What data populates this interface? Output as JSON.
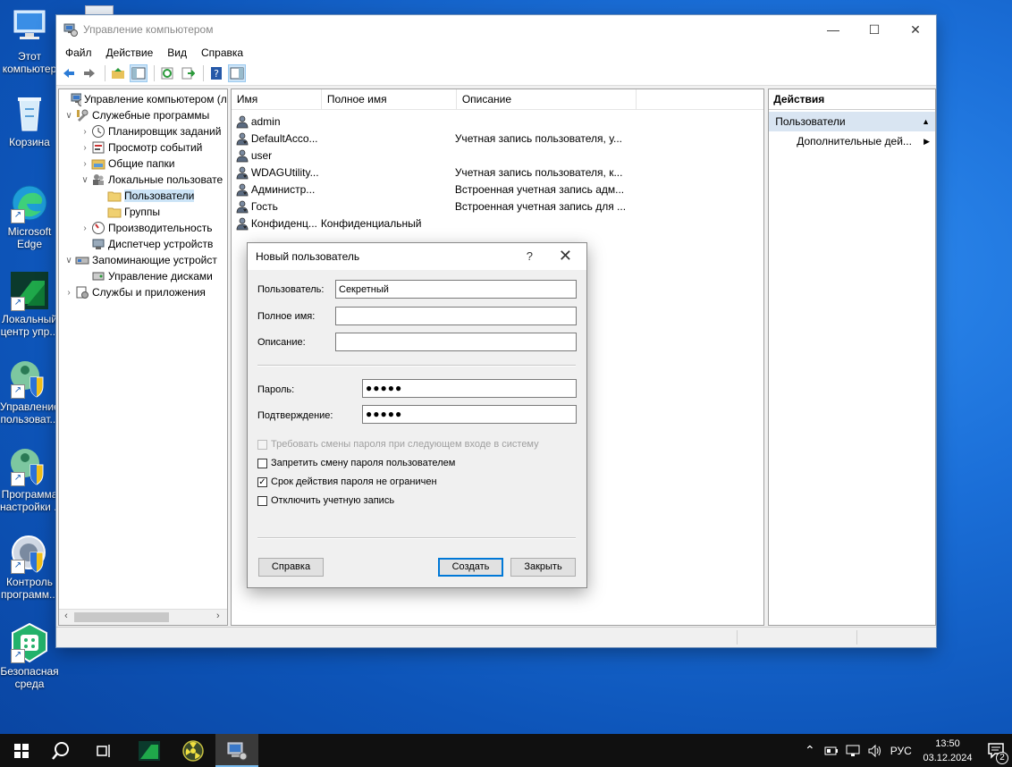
{
  "desktop": {
    "icons": [
      {
        "label1": "Этот",
        "label2": "компьютер"
      },
      {
        "label1": "Корзина",
        "label2": ""
      },
      {
        "label1": "Microsoft",
        "label2": "Edge"
      },
      {
        "label1": "Локальный",
        "label2": "центр упр..."
      },
      {
        "label1": "Управление",
        "label2": "пользоват..."
      },
      {
        "label1": "Программа",
        "label2": "настройки ..."
      },
      {
        "label1": "Контроль",
        "label2": "программ..."
      },
      {
        "label1": "Безопасная",
        "label2": "среда"
      }
    ]
  },
  "window": {
    "title": "Управление компьютером",
    "menu": [
      "Файл",
      "Действие",
      "Вид",
      "Справка"
    ]
  },
  "tree": [
    {
      "label": "Управление компьютером (л"
    },
    {
      "label": "Служебные программы"
    },
    {
      "label": "Планировщик заданий"
    },
    {
      "label": "Просмотр событий"
    },
    {
      "label": "Общие папки"
    },
    {
      "label": "Локальные пользовате"
    },
    {
      "label": "Пользователи"
    },
    {
      "label": "Группы"
    },
    {
      "label": "Производительность"
    },
    {
      "label": "Диспетчер устройств"
    },
    {
      "label": "Запоминающие устройст"
    },
    {
      "label": "Управление дисками"
    },
    {
      "label": "Службы и приложения"
    }
  ],
  "list": {
    "columns": [
      "Имя",
      "Полное имя",
      "Описание"
    ],
    "rows": [
      {
        "name": "admin",
        "full": "",
        "desc": ""
      },
      {
        "name": "DefaultAcco...",
        "full": "",
        "desc": "Учетная запись пользователя, у..."
      },
      {
        "name": "user",
        "full": "",
        "desc": ""
      },
      {
        "name": "WDAGUtility...",
        "full": "",
        "desc": "Учетная запись пользователя, к..."
      },
      {
        "name": "Администр...",
        "full": "",
        "desc": "Встроенная учетная запись адм..."
      },
      {
        "name": "Гость",
        "full": "",
        "desc": "Встроенная учетная запись для ..."
      },
      {
        "name": "Конфиденц...",
        "full": "Конфиденциальный",
        "desc": ""
      }
    ]
  },
  "actions": {
    "header": "Действия",
    "section": "Пользователи",
    "item": "Дополнительные дей..."
  },
  "dialog": {
    "title": "Новый пользователь",
    "help": "?",
    "username_label": "Пользователь:",
    "username_value": "Секретный",
    "fullname_label": "Полное имя:",
    "fullname_value": "",
    "desc_label": "Описание:",
    "desc_value": "",
    "password_label": "Пароль:",
    "password_value": "●●●●●",
    "confirm_label": "Подтверждение:",
    "confirm_value": "●●●●●",
    "chk_must_change": "Требовать смены пароля при следующем входе в систему",
    "chk_cannot_change": "Запретить смену пароля пользователем",
    "chk_never_expires": "Срок действия пароля не ограничен",
    "chk_disabled": "Отключить учетную запись",
    "btn_help": "Справка",
    "btn_create": "Создать",
    "btn_close": "Закрыть"
  },
  "taskbar": {
    "lang": "РУС",
    "time": "13:50",
    "date": "03.12.2024",
    "notifications": "2"
  }
}
